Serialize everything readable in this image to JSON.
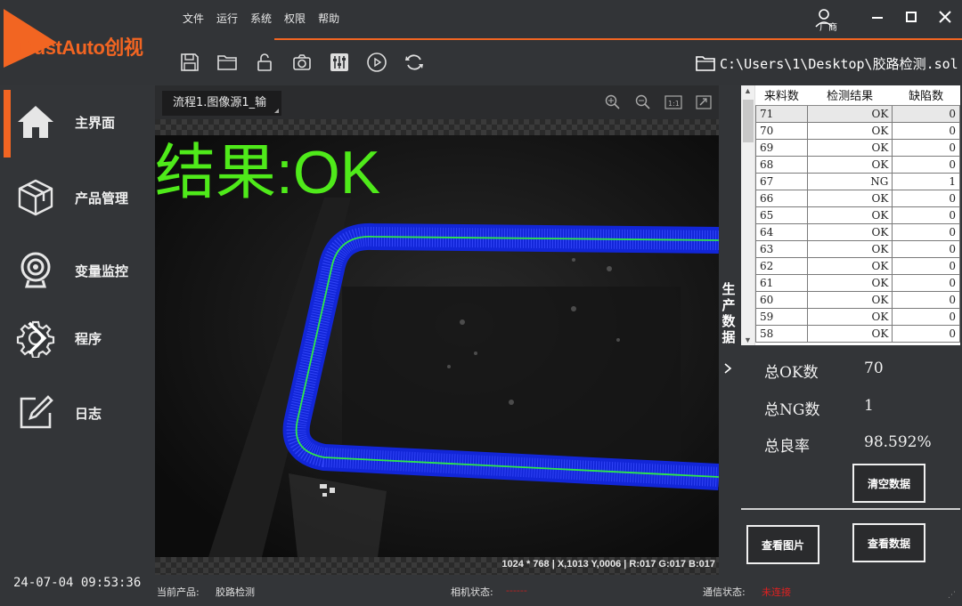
{
  "app": {
    "logo_text": "TrustAuto创视",
    "brand_color": "#f26522"
  },
  "menu": [
    "文件",
    "运行",
    "系统",
    "权限",
    "帮助"
  ],
  "user": {
    "icon": "user-icon",
    "caption": "厂商"
  },
  "window_controls": [
    "minimize",
    "maximize",
    "close"
  ],
  "toolbar": {
    "icons": [
      "save-icon",
      "open-folder-icon",
      "lock-icon",
      "camera-icon",
      "settings-sliders-icon",
      "play-icon",
      "refresh-icon"
    ],
    "file_path": "C:\\Users\\1\\Desktop\\胶路检测.sol"
  },
  "sidebar": {
    "items": [
      {
        "label": "主界面",
        "icon": "home-icon",
        "active": true
      },
      {
        "label": "产品管理",
        "icon": "cube-icon"
      },
      {
        "label": "变量监控",
        "icon": "webcam-icon"
      },
      {
        "label": "程序",
        "icon": "gear-icon"
      },
      {
        "label": "日志",
        "icon": "edit-icon"
      }
    ],
    "datetime": "24-07-04 09:53:36"
  },
  "view": {
    "tab_label": "流程1.图像源1_输",
    "tools": [
      "zoom-in-icon",
      "zoom-out-icon",
      "actual-size-icon",
      "fit-icon"
    ],
    "result_text": "结果:OK",
    "pixel_info": "1024 * 768 | X,1013 Y,0006 | R:017 G:017 B:017"
  },
  "production": {
    "side_tag": "生产数据",
    "columns": [
      "来料数",
      "检测结果",
      "缺陷数"
    ],
    "rows": [
      [
        "71",
        "OK",
        "0"
      ],
      [
        "70",
        "OK",
        "0"
      ],
      [
        "69",
        "OK",
        "0"
      ],
      [
        "68",
        "OK",
        "0"
      ],
      [
        "67",
        "NG",
        "1"
      ],
      [
        "66",
        "OK",
        "0"
      ],
      [
        "65",
        "OK",
        "0"
      ],
      [
        "64",
        "OK",
        "0"
      ],
      [
        "63",
        "OK",
        "0"
      ],
      [
        "62",
        "OK",
        "0"
      ],
      [
        "61",
        "OK",
        "0"
      ],
      [
        "60",
        "OK",
        "0"
      ],
      [
        "59",
        "OK",
        "0"
      ],
      [
        "58",
        "OK",
        "0"
      ]
    ],
    "stats": [
      {
        "label": "总OK数",
        "value": "70"
      },
      {
        "label": "总NG数",
        "value": "1"
      },
      {
        "label": "总良率",
        "value": "98.592%"
      }
    ],
    "clear_button": "清空数据",
    "view_images_button": "查看图片",
    "view_data_button": "查看数据"
  },
  "status": {
    "product_label": "当前产品:",
    "product_value": "胶路检测",
    "camera_label": "相机状态:",
    "camera_value": "------",
    "comm_label": "通信状态:",
    "comm_value": "未连接",
    "comm_color": "#e02020"
  }
}
